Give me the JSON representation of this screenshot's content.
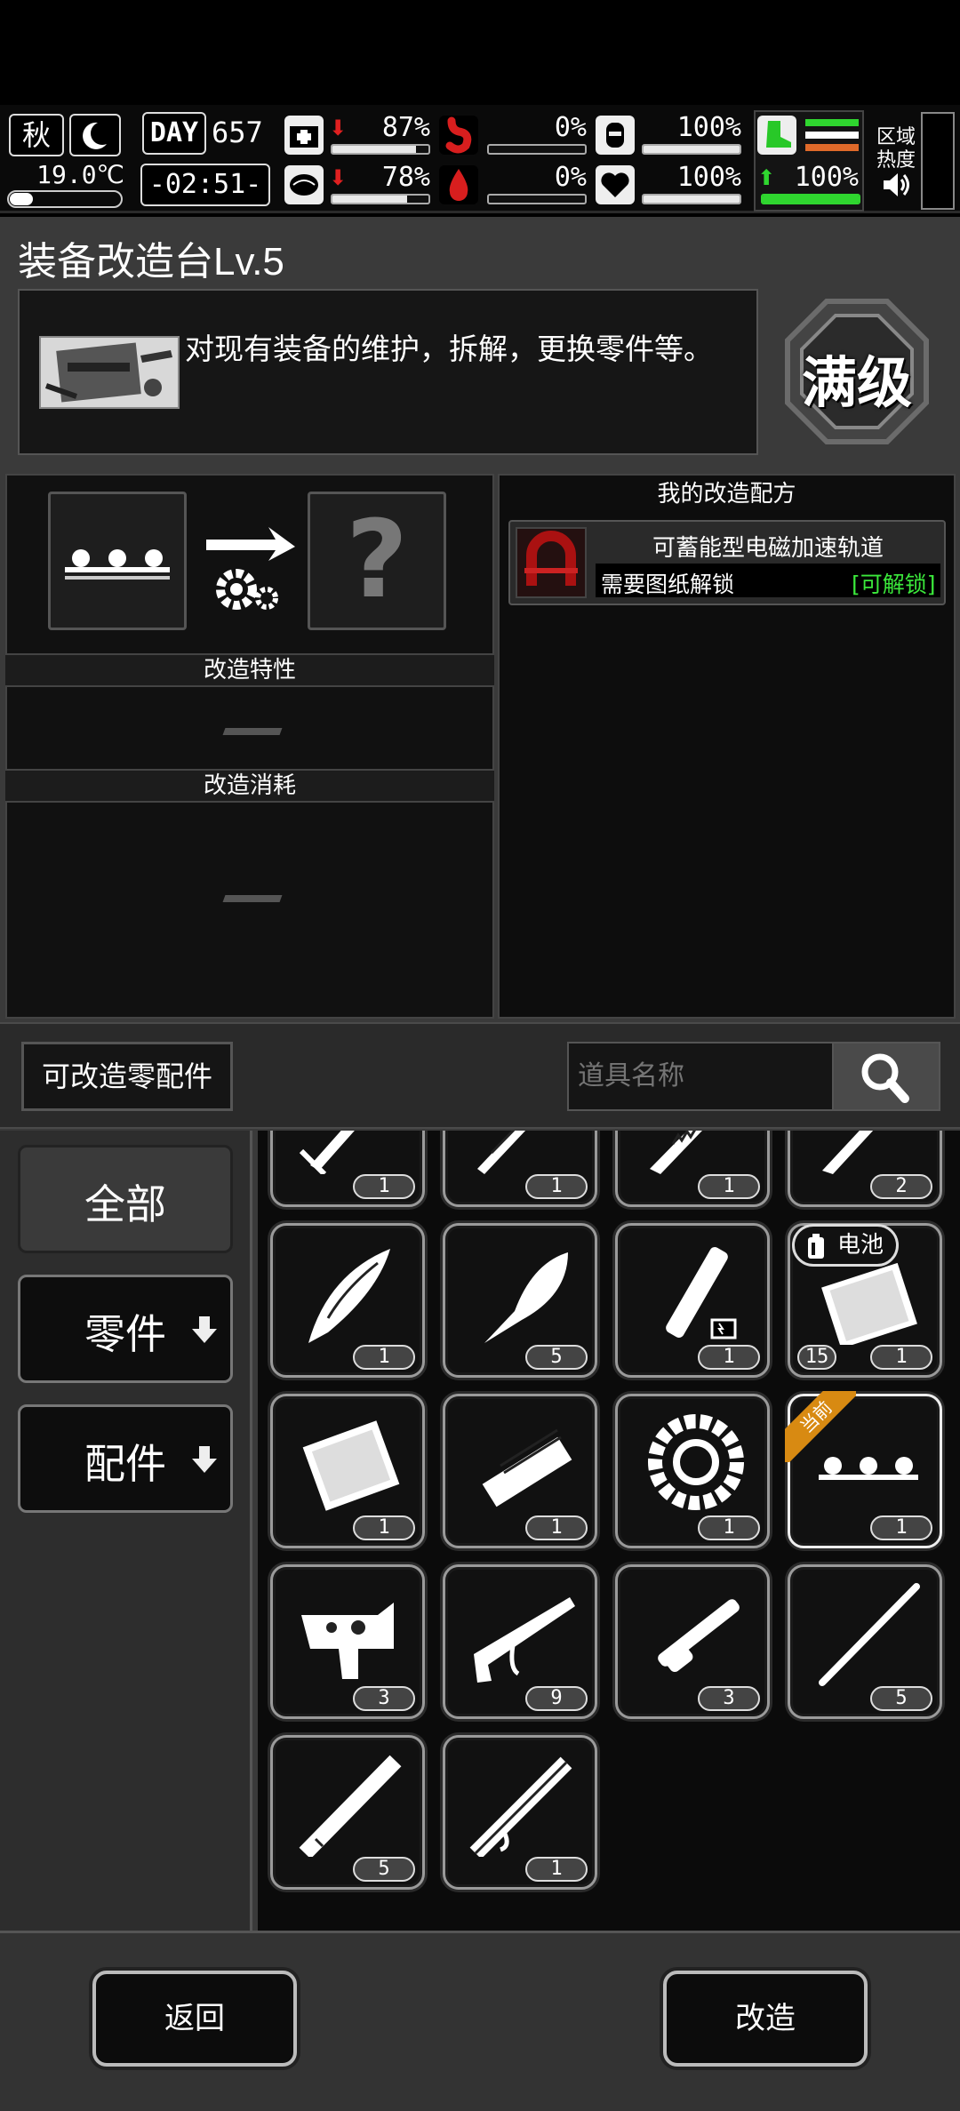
{
  "status": {
    "season": "秋",
    "temperature": "19.0℃",
    "day_label": "DAY",
    "day_number": "657",
    "time": "-02:51-",
    "health_pct": "87%",
    "mental_pct": "78%",
    "hunger_pct": "0%",
    "thirst_pct": "0%",
    "armor_pct": "100%",
    "mood_pct": "100%",
    "stamina_pct": "100%",
    "area_label_1": "区域",
    "area_label_2": "热度",
    "bars": {
      "health": 0.87,
      "mental": 0.78,
      "hunger": 0.0,
      "thirst": 0.0,
      "armor": 1.0,
      "mood": 1.0,
      "stamina": 1.0
    },
    "colors": {
      "hunger_icon": "#d81e1e",
      "stamina_icon": "#28c828",
      "stamina_bar": "#2fd62f",
      "area_bar_1": "#2fd62f",
      "area_bar_2": "#e06a2a"
    }
  },
  "header": {
    "title": "装备改造台Lv.5",
    "description": "对现有装备的维护，拆解，更换零件等。",
    "max_badge": "满级"
  },
  "craft": {
    "traits_label": "改造特性",
    "cost_label": "改造消耗"
  },
  "recipes": {
    "title": "我的改造配方",
    "items": [
      {
        "name": "可蓄能型电磁加速轨道",
        "requirement": "需要图纸解锁",
        "status": "[可解锁]"
      }
    ]
  },
  "filter": {
    "parts_button": "可改造零配件",
    "search_placeholder": "道具名称"
  },
  "categories": [
    {
      "label": "全部"
    },
    {
      "label": "零件"
    },
    {
      "label": "配件"
    }
  ],
  "grid_items": [
    {
      "icon": "dagger-icon",
      "count": "1"
    },
    {
      "icon": "long-blade-icon",
      "count": "1"
    },
    {
      "icon": "serrated-blade-icon",
      "count": "1"
    },
    {
      "icon": "machete-icon",
      "count": "2"
    },
    {
      "icon": "curved-blade-icon",
      "count": "1"
    },
    {
      "icon": "kukri-blade-icon",
      "count": "5"
    },
    {
      "icon": "energy-cell-icon",
      "count": "1"
    },
    {
      "icon": "battery-pack-icon",
      "count": "1",
      "tag": "电池",
      "left_count": "15"
    },
    {
      "icon": "armor-plate-icon",
      "count": "1"
    },
    {
      "icon": "gatling-barrel-icon",
      "count": "1"
    },
    {
      "icon": "cylinder-gear-icon",
      "count": "1"
    },
    {
      "icon": "rail-module-icon",
      "count": "1",
      "corner_tag": "当前"
    },
    {
      "icon": "trigger-group-icon",
      "count": "3"
    },
    {
      "icon": "rifle-stock-icon",
      "count": "9"
    },
    {
      "icon": "scope-icon",
      "count": "3"
    },
    {
      "icon": "thin-rod-icon",
      "count": "5"
    },
    {
      "icon": "barrel-tube-icon",
      "count": "5"
    },
    {
      "icon": "shotgun-barrel-icon",
      "count": "1"
    }
  ],
  "actions": {
    "back": "返回",
    "upgrade": "改造"
  }
}
